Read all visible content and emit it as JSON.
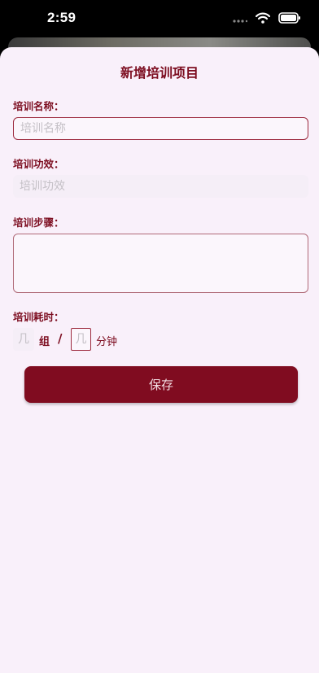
{
  "status_bar": {
    "time": "2:59",
    "icons": [
      "signal-dots-icon",
      "wifi-icon",
      "battery-icon"
    ]
  },
  "form": {
    "title": "新增培训项目",
    "name": {
      "label": "培训名称：",
      "placeholder": "培训名称",
      "value": ""
    },
    "effect": {
      "label": "培训功效：",
      "placeholder": "培训功效",
      "value": ""
    },
    "steps": {
      "label": "培训步骤：",
      "placeholder": "",
      "value": ""
    },
    "duration": {
      "label": "培训耗时：",
      "groups_placeholder": "几",
      "groups_unit": "组",
      "separator": "/",
      "minutes_placeholder": "几",
      "minutes_unit": "分钟"
    },
    "save_label": "保存"
  },
  "colors": {
    "accent": "#800c20",
    "label_text": "#7c0c1f",
    "sheet_background": "#f9f0fa",
    "input_border": "#9d2a3e"
  }
}
